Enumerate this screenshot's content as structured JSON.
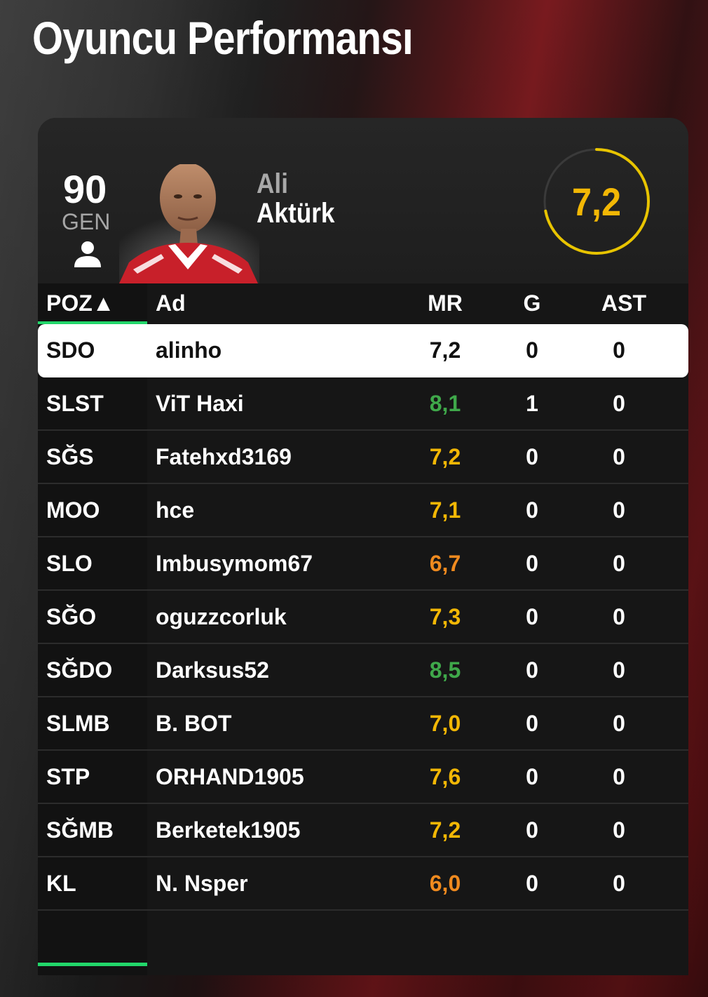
{
  "page": {
    "title": "Oyuncu Performansı"
  },
  "player_card": {
    "overall": "90",
    "overall_label": "GEN",
    "first_name": "Ali",
    "last_name": "Aktürk",
    "match_rating": "7,2",
    "rating_fraction": 0.72,
    "rating_color": "#f2b705"
  },
  "table": {
    "headers": {
      "pos": "POZ▲",
      "name": "Ad",
      "rating": "MR",
      "goals": "G",
      "assists": "AST"
    },
    "rows": [
      {
        "pos": "SDO",
        "name": "alinho",
        "mr": "7,2",
        "g": "0",
        "ast": "0",
        "mr_color": "#111111",
        "selected": true
      },
      {
        "pos": "SLST",
        "name": "ViT Haxi",
        "mr": "8,1",
        "g": "1",
        "ast": "0",
        "mr_color": "#3fa84a",
        "selected": false
      },
      {
        "pos": "SĞS",
        "name": "Fatehxd3169",
        "mr": "7,2",
        "g": "0",
        "ast": "0",
        "mr_color": "#f2b705",
        "selected": false
      },
      {
        "pos": "MOO",
        "name": "hce",
        "mr": "7,1",
        "g": "0",
        "ast": "0",
        "mr_color": "#f2b705",
        "selected": false
      },
      {
        "pos": "SLO",
        "name": "Imbusymom67",
        "mr": "6,7",
        "g": "0",
        "ast": "0",
        "mr_color": "#ef8a1f",
        "selected": false
      },
      {
        "pos": "SĞO",
        "name": "oguzzcorluk",
        "mr": "7,3",
        "g": "0",
        "ast": "0",
        "mr_color": "#f2b705",
        "selected": false
      },
      {
        "pos": "SĞDO",
        "name": "Darksus52",
        "mr": "8,5",
        "g": "0",
        "ast": "0",
        "mr_color": "#3fa84a",
        "selected": false
      },
      {
        "pos": "SLMB",
        "name": "B. BOT",
        "mr": "7,0",
        "g": "0",
        "ast": "0",
        "mr_color": "#f2b705",
        "selected": false
      },
      {
        "pos": "STP",
        "name": "ORHAND1905",
        "mr": "7,6",
        "g": "0",
        "ast": "0",
        "mr_color": "#f2b705",
        "selected": false
      },
      {
        "pos": "SĞMB",
        "name": "Berketek1905",
        "mr": "7,2",
        "g": "0",
        "ast": "0",
        "mr_color": "#f2b705",
        "selected": false
      },
      {
        "pos": "KL",
        "name": "N. Nsper",
        "mr": "6,0",
        "g": "0",
        "ast": "0",
        "mr_color": "#ef8a1f",
        "selected": false
      }
    ]
  }
}
